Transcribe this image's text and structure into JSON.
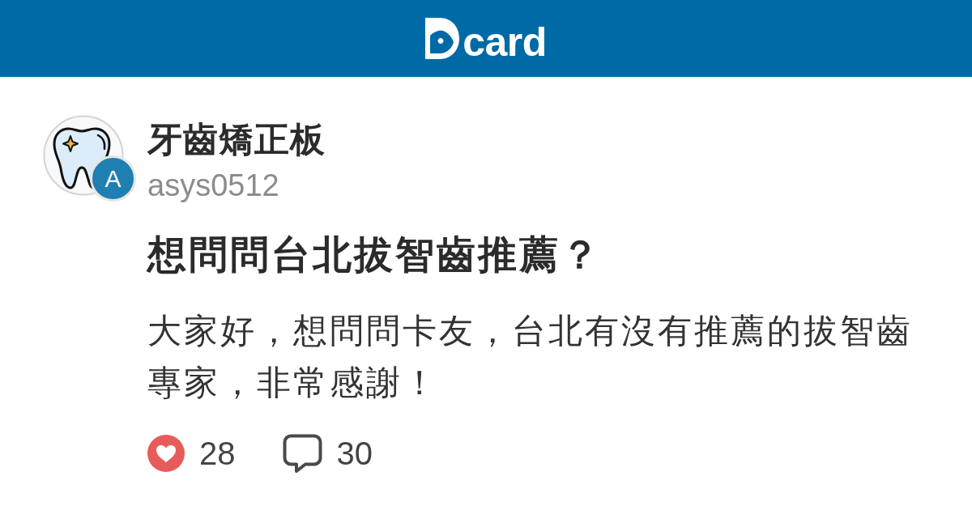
{
  "header": {
    "logo_text": "card"
  },
  "post": {
    "forum": "牙齒矯正板",
    "author_initial": "A",
    "author": "asys0512",
    "title": "想問問台北拔智齒推薦？",
    "body": "大家好，想問問卡友，台北有沒有推薦的拔智齒專家，非常感謝！",
    "likes": "28",
    "comments": "30"
  }
}
